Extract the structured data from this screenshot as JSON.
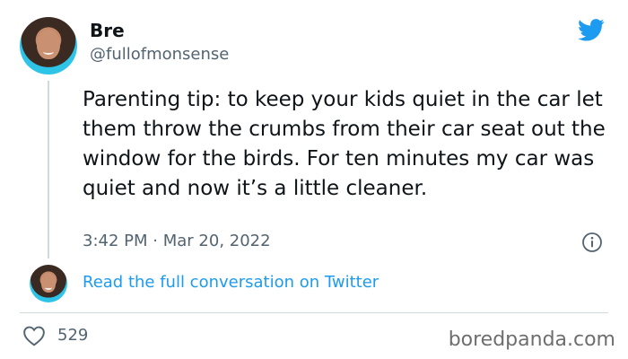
{
  "author": {
    "name": "Bre",
    "handle": "@fullofmonsense"
  },
  "tweet": {
    "text": "Parenting tip: to keep your kids quiet in the car let them throw the crumbs from their car seat out the window for the birds. For ten minutes my car was quiet and now it’s a little cleaner.",
    "time": "3:42 PM",
    "separator": "·",
    "date": "Mar 20, 2022"
  },
  "conversation": {
    "link_label": "Read the full conversation on Twitter"
  },
  "stats": {
    "likes": "529"
  },
  "watermark": "boredpanda.com",
  "icons": {
    "brand": "twitter-bird-icon",
    "info": "info-icon",
    "like": "heart-icon"
  },
  "colors": {
    "accent": "#1d9bf0",
    "text": "#0f1419",
    "muted": "#536471",
    "avatar_ring": "#2ec4e8"
  }
}
